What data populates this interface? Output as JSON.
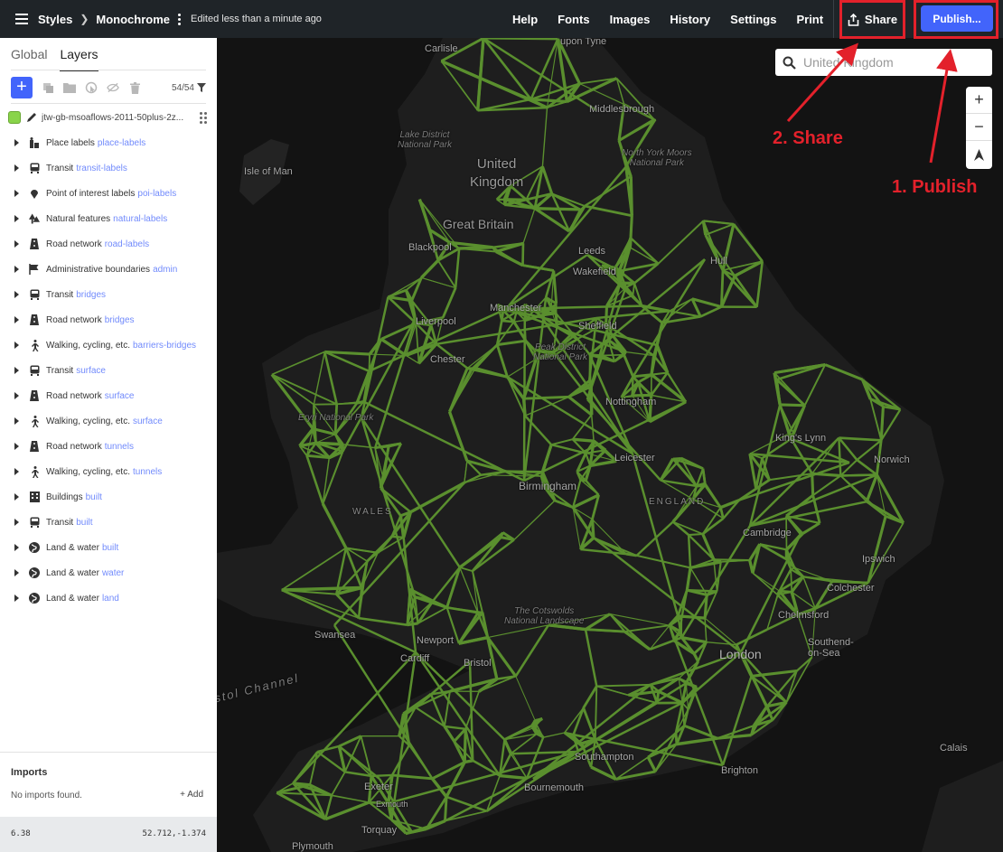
{
  "header": {
    "crumb_styles": "Styles",
    "crumb_style_name": "Monochrome",
    "edited": "Edited less than a minute ago",
    "nav": [
      "Help",
      "Fonts",
      "Images",
      "History",
      "Settings",
      "Print"
    ],
    "share_label": "Share",
    "publish_label": "Publish..."
  },
  "sidebar": {
    "tabs": {
      "global": "Global",
      "layers": "Layers"
    },
    "layer_count": "54/54",
    "source": {
      "name": "jtw-gb-msoaflows-2011-50plus-2z...",
      "color": "#89d44a"
    },
    "layers": [
      {
        "icon": "place-icon",
        "label": "Place labels",
        "id": "place-labels"
      },
      {
        "icon": "transit-icon",
        "label": "Transit",
        "id": "transit-labels"
      },
      {
        "icon": "poi-icon",
        "label": "Point of interest labels",
        "id": "poi-labels"
      },
      {
        "icon": "nature-icon",
        "label": "Natural features",
        "id": "natural-labels"
      },
      {
        "icon": "road-icon",
        "label": "Road network",
        "id": "road-labels"
      },
      {
        "icon": "admin-icon",
        "label": "Administrative boundaries",
        "id": "admin"
      },
      {
        "icon": "transit-icon",
        "label": "Transit",
        "id": "bridges"
      },
      {
        "icon": "road-icon",
        "label": "Road network",
        "id": "bridges"
      },
      {
        "icon": "walking-icon",
        "label": "Walking, cycling, etc.",
        "id": "barriers-bridges"
      },
      {
        "icon": "transit-icon",
        "label": "Transit",
        "id": "surface"
      },
      {
        "icon": "road-icon",
        "label": "Road network",
        "id": "surface"
      },
      {
        "icon": "walking-icon",
        "label": "Walking, cycling, etc.",
        "id": "surface"
      },
      {
        "icon": "road-icon",
        "label": "Road network",
        "id": "tunnels"
      },
      {
        "icon": "walking-icon",
        "label": "Walking, cycling, etc.",
        "id": "tunnels"
      },
      {
        "icon": "building-icon",
        "label": "Buildings",
        "id": "built"
      },
      {
        "icon": "transit-icon",
        "label": "Transit",
        "id": "built"
      },
      {
        "icon": "globe-icon",
        "label": "Land & water",
        "id": "built"
      },
      {
        "icon": "globe-icon",
        "label": "Land & water",
        "id": "water"
      },
      {
        "icon": "globe-icon",
        "label": "Land & water",
        "id": "land"
      }
    ],
    "imports": {
      "title": "Imports",
      "empty": "No imports found.",
      "add": "+ Add"
    },
    "footer": {
      "zoom": "6.38",
      "coords": "52.712,-1.374"
    }
  },
  "map": {
    "search_value": "United Kingdom",
    "flow_color": "#5a8f2e",
    "labels": {
      "isle_of_man": "Isle of Man",
      "united_kingdom": "United\nKingdom",
      "great_britain": "Great Britain",
      "lake_district": "Lake District\nNational Park",
      "north_york_moors": "North York Moors\nNational Park",
      "middlesbrough": "Middlesbrough",
      "blackpool": "Blackpool",
      "leeds": "Leeds",
      "wakefield": "Wakefield",
      "hull": "Hull",
      "manchester": "Manchester",
      "liverpool": "Liverpool",
      "sheffield": "Sheffield",
      "peak_district": "Peak District\nNational Park",
      "chester": "Chester",
      "nottingham": "Nottingham",
      "eryri": "Eryri National Park",
      "kings_lynn": "King's Lynn",
      "norwich": "Norwich",
      "leicester": "Leicester",
      "birmingham": "Birmingham",
      "england": "ENGLAND",
      "wales": "WALES",
      "cambridge": "Cambridge",
      "ipswich": "Ipswich",
      "colchester": "Colchester",
      "cotswolds": "The Cotswolds\nNational Landscape",
      "chelmsford": "Chelmsford",
      "swansea": "Swansea",
      "newport": "Newport",
      "cardiff": "Cardiff",
      "bristol": "Bristol",
      "london": "London",
      "southend": "Southend-\non-Sea",
      "bristol_channel": "stol Channel",
      "southampton": "Southampton",
      "brighton": "Brighton",
      "bournemouth": "Bournemouth",
      "exeter": "Exeter",
      "exmouth": "Exmouth",
      "torquay": "Torquay",
      "plymouth": "Plymouth",
      "calais": "Calais",
      "carlisle": "Carlisle",
      "newcastle": "upon Tyne"
    }
  },
  "annotations": {
    "share": "2. Share",
    "publish": "1. Publish",
    "color": "#e3212b"
  }
}
